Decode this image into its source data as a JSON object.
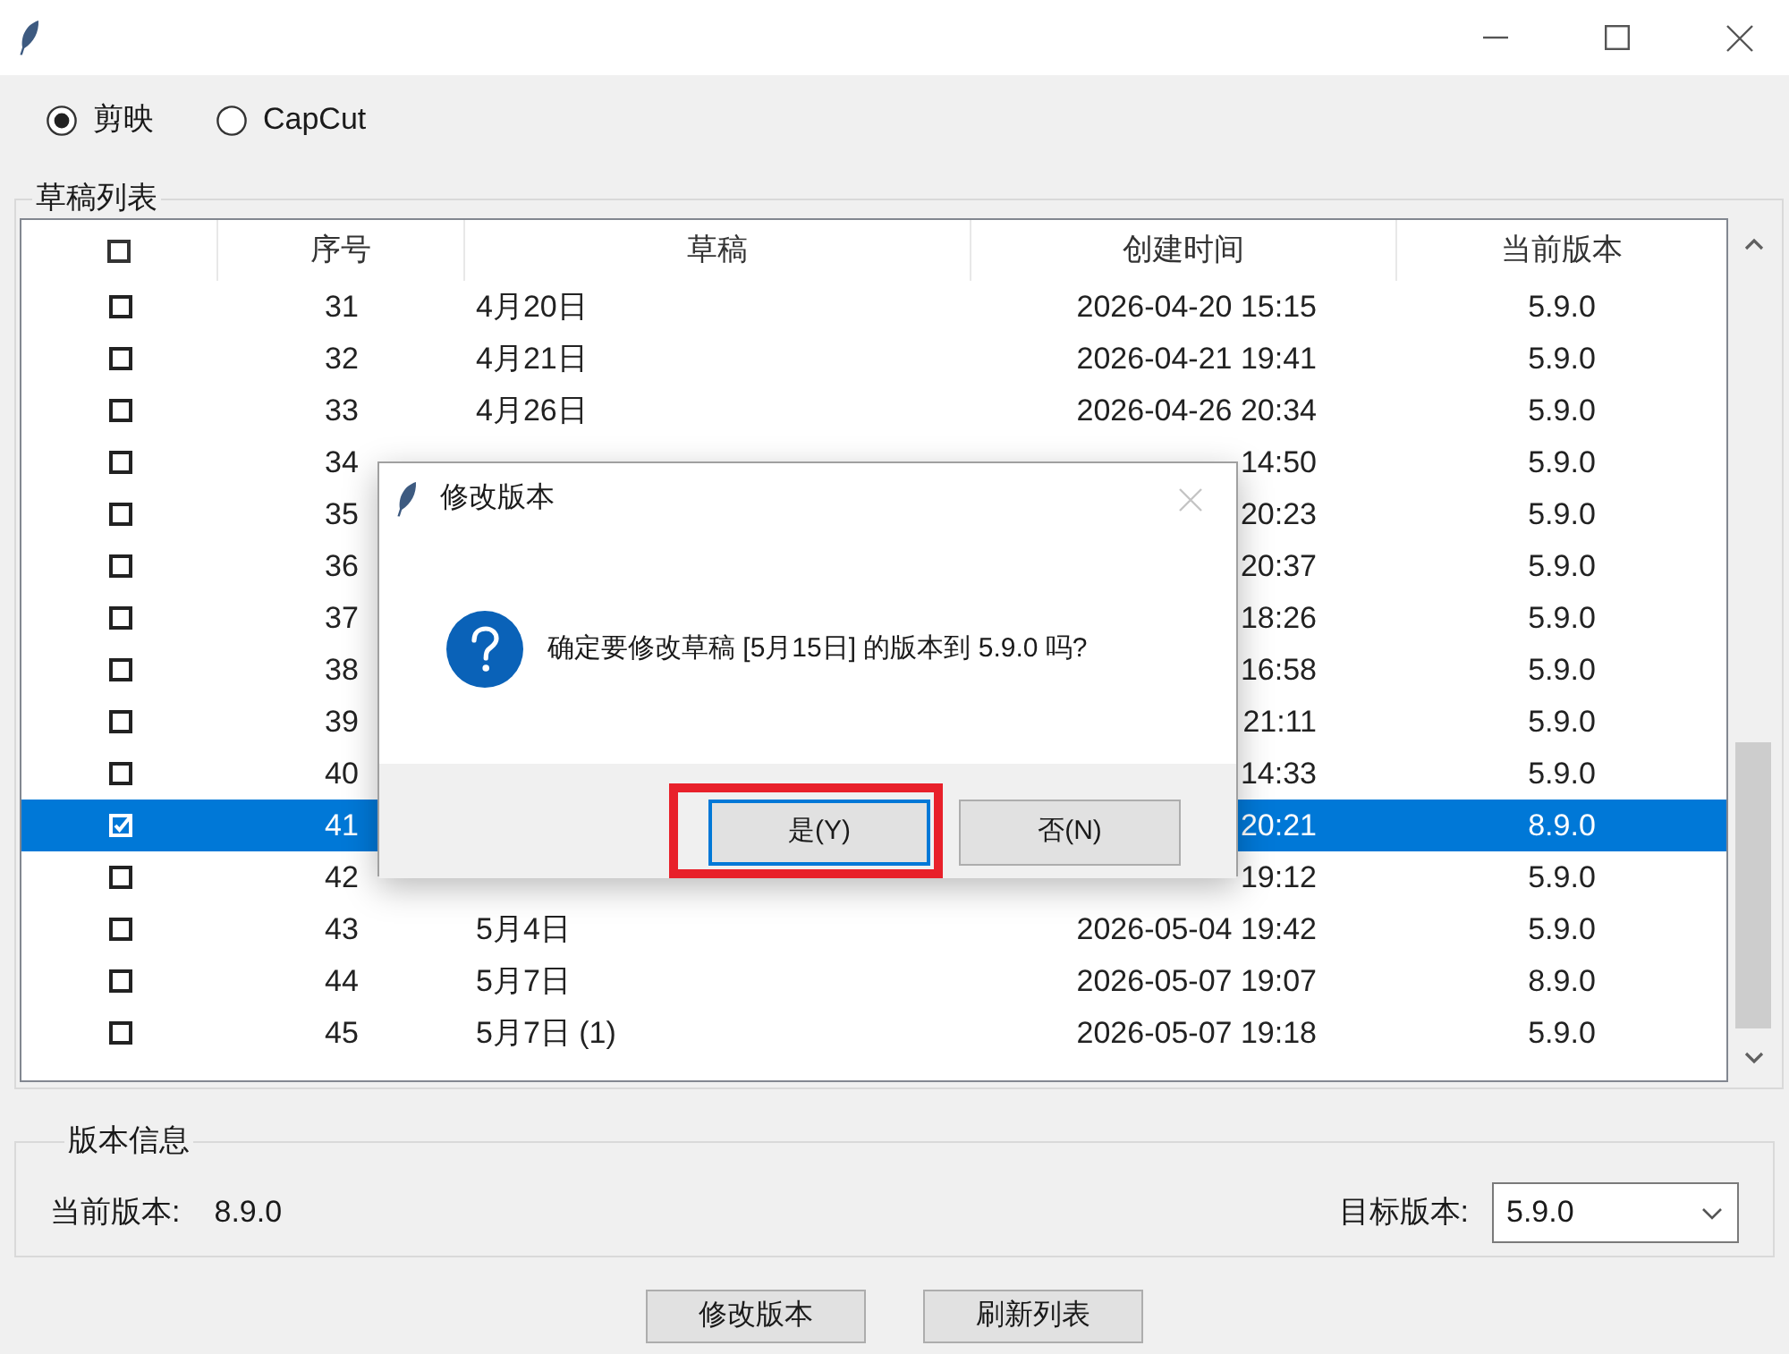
{
  "source_options": [
    {
      "label": "剪映",
      "selected": true
    },
    {
      "label": "CapCut",
      "selected": false
    }
  ],
  "draft_list": {
    "title": "草稿列表",
    "select_all": {
      "checked": false
    },
    "columns": [
      "序号",
      "草稿",
      "创建时间",
      "当前版本"
    ],
    "rows": [
      {
        "checked": false,
        "selected": false,
        "number": "31",
        "draft": "4月20日",
        "created": "2026-04-20 15:15",
        "version": "5.9.0"
      },
      {
        "checked": false,
        "selected": false,
        "number": "32",
        "draft": "4月21日",
        "created": "2026-04-21 19:41",
        "version": "5.9.0"
      },
      {
        "checked": false,
        "selected": false,
        "number": "33",
        "draft": "4月26日",
        "created": "2026-04-26 20:34",
        "version": "5.9.0"
      },
      {
        "checked": false,
        "selected": false,
        "number": "34",
        "created": "14:50",
        "version": "5.9.0"
      },
      {
        "checked": false,
        "selected": false,
        "number": "35",
        "created": "20:23",
        "version": "5.9.0"
      },
      {
        "checked": false,
        "selected": false,
        "number": "36",
        "created": "20:37",
        "version": "5.9.0"
      },
      {
        "checked": false,
        "selected": false,
        "number": "37",
        "created": "18:26",
        "version": "5.9.0"
      },
      {
        "checked": false,
        "selected": false,
        "number": "38",
        "created": "16:58",
        "version": "5.9.0"
      },
      {
        "checked": false,
        "selected": false,
        "number": "39",
        "created": "21:11",
        "version": "5.9.0"
      },
      {
        "checked": false,
        "selected": false,
        "number": "40",
        "created": "14:33",
        "version": "5.9.0"
      },
      {
        "checked": true,
        "selected": true,
        "number": "41",
        "created": "20:21",
        "version": "8.9.0"
      },
      {
        "checked": false,
        "selected": false,
        "number": "42",
        "created": "19:12",
        "version": "5.9.0"
      },
      {
        "checked": false,
        "selected": false,
        "number": "43",
        "draft": "5月4日",
        "created": "2026-05-04 19:42",
        "version": "5.9.0"
      },
      {
        "checked": false,
        "selected": false,
        "number": "44",
        "draft": "5月7日",
        "created": "2026-05-07 19:07",
        "version": "8.9.0"
      },
      {
        "checked": false,
        "selected": false,
        "number": "45",
        "draft": "5月7日 (1)",
        "created": "2026-05-07 19:18",
        "version": "5.9.0"
      }
    ]
  },
  "version_info": {
    "title": "版本信息",
    "current_label": "当前版本:",
    "current_value": "8.9.0",
    "target_label": "目标版本:",
    "target_value": "5.9.0"
  },
  "buttons": [
    "修改版本",
    "刷新列表"
  ],
  "dialog": {
    "title": "修改版本",
    "message": "确定要修改草稿 [5月15日] 的版本到 5.9.0 吗?",
    "buttons": [
      {
        "label": "是(Y)",
        "focused": true,
        "highlighted": true
      },
      {
        "label": "否(N)",
        "focused": false,
        "highlighted": false
      }
    ]
  }
}
